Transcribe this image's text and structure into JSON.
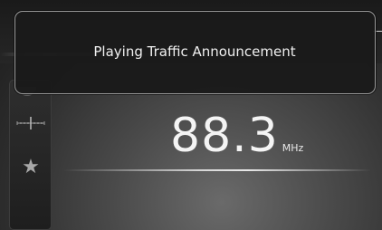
{
  "popup": {
    "message": "Playing Traffic Announcement"
  },
  "tuner": {
    "frequency": "88.3",
    "unit": "MHz"
  },
  "side_panel": {
    "icons": [
      "tune-icon",
      "favorite-star-icon"
    ]
  },
  "colors": {
    "popup_border": "#9a9a9a",
    "popup_background": "#1a1a1a",
    "text": "#f4f4f4",
    "icon": "#a8a8a8"
  }
}
